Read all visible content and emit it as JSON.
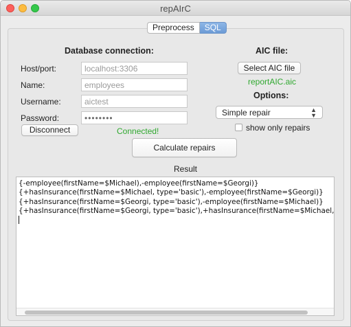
{
  "window": {
    "title": "repAIrC"
  },
  "tabs": [
    {
      "label": "Preprocess",
      "active": false
    },
    {
      "label": "SQL",
      "active": true
    }
  ],
  "database": {
    "heading": "Database connection:",
    "host_label": "Host/port:",
    "host_value": "localhost:3306",
    "name_label": "Name:",
    "name_value": "employees",
    "username_label": "Username:",
    "username_value": "aictest",
    "password_label": "Password:",
    "password_value": "••••••••",
    "disconnect_label": "Disconnect",
    "status": "Connected!"
  },
  "aic": {
    "heading": "AIC file:",
    "select_label": "Select AIC file",
    "file_name": "reportAIC.aic",
    "options_heading": "Options:",
    "repair_mode": "Simple repair",
    "show_only_repairs_label": "show only repairs",
    "show_only_repairs_checked": false
  },
  "actions": {
    "calculate_label": "Calculate repairs"
  },
  "result": {
    "label": "Result",
    "lines": [
      "{-employee(firstName=$Michael),-employee(firstName=$Georgi)}",
      "{+hasInsurance(firstName=$Michael, type='basic'),-employee(firstName=$Georgi)}",
      "{+hasInsurance(firstName=$Georgi, type='basic'),-employee(firstName=$Michael)}",
      "{+hasInsurance(firstName=$Georgi, type='basic'),+hasInsurance(firstName=$Michael, type='basic')}"
    ]
  },
  "colors": {
    "status_green": "#2fa82f",
    "active_tab": "#6c9bd6"
  }
}
